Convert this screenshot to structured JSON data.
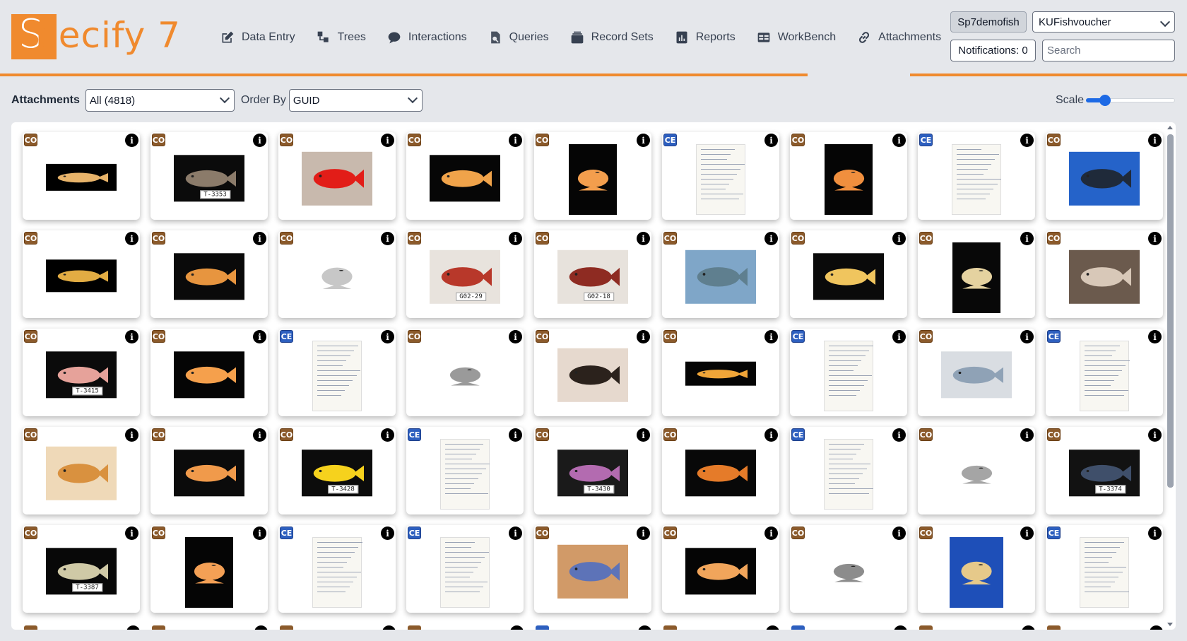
{
  "app": {
    "logo_text": "Specify 7"
  },
  "nav": [
    {
      "label": "Data Entry",
      "icon": "pencil-square-icon"
    },
    {
      "label": "Trees",
      "icon": "tree-icon"
    },
    {
      "label": "Interactions",
      "icon": "chat-icon"
    },
    {
      "label": "Queries",
      "icon": "magnifier-document-icon"
    },
    {
      "label": "Record Sets",
      "icon": "stack-icon"
    },
    {
      "label": "Reports",
      "icon": "report-icon"
    },
    {
      "label": "WorkBench",
      "icon": "table-icon"
    },
    {
      "label": "Attachments",
      "icon": "link-icon"
    }
  ],
  "header": {
    "user": "Sp7demofish",
    "collection": "KUFishvoucher",
    "notifications": "Notifications: 0",
    "search_placeholder": "Search"
  },
  "toolbar": {
    "label": "Attachments",
    "filter_value": "All (4818)",
    "orderby_label": "Order By",
    "orderby_value": "GUID",
    "scale_label": "Scale",
    "scale_level": 0.15
  },
  "colors": {
    "accent": "#f08a2e",
    "co_badge": "#8b5a2b",
    "ce_badge": "#2d5fbf",
    "slider": "#1d6ae5"
  },
  "gallery": {
    "cards": [
      {
        "badge": "CO",
        "thumb": "fish",
        "bg": "#000000",
        "fish": "#e7b36a",
        "w": 100,
        "h": 38,
        "tag": ""
      },
      {
        "badge": "CO",
        "thumb": "fish",
        "bg": "#0b0b0b",
        "fish": "#8b7b6a",
        "w": 100,
        "h": 66,
        "tag": "T-3353"
      },
      {
        "badge": "CO",
        "thumb": "fish",
        "bg": "#c8b9ad",
        "fish": "#e21d18",
        "w": 100,
        "h": 76,
        "tag": ""
      },
      {
        "badge": "CO",
        "thumb": "fish",
        "bg": "#060606",
        "fish": "#f0a34a",
        "w": 100,
        "h": 66,
        "tag": ""
      },
      {
        "badge": "CO",
        "thumb": "fish",
        "bg": "#050505",
        "fish": "#f39e4d",
        "w": 68,
        "h": 100,
        "tag": ""
      },
      {
        "badge": "CE",
        "thumb": "doc",
        "w": 70,
        "h": 100
      },
      {
        "badge": "CO",
        "thumb": "fish",
        "bg": "#050505",
        "fish": "#f08f3e",
        "w": 68,
        "h": 100,
        "tag": ""
      },
      {
        "badge": "CE",
        "thumb": "doc",
        "w": 70,
        "h": 100
      },
      {
        "badge": "CO",
        "thumb": "fish",
        "bg": "#2563c9",
        "fish": "#1f2a3a",
        "w": 100,
        "h": 76,
        "tag": ""
      },
      {
        "badge": "CO",
        "thumb": "fish",
        "bg": "#000000",
        "fish": "#e2ac43",
        "w": 100,
        "h": 46,
        "tag": ""
      },
      {
        "badge": "CO",
        "thumb": "fish",
        "bg": "#0a0a0a",
        "fish": "#e7953f",
        "w": 100,
        "h": 66,
        "tag": ""
      },
      {
        "badge": "CO",
        "thumb": "fish",
        "bg": "#ffffff",
        "fish": "#c7c7c7",
        "w": 70,
        "h": 100,
        "tag": ""
      },
      {
        "badge": "CO",
        "thumb": "fish",
        "bg": "#e8e3dd",
        "fish": "#b8382a",
        "w": 100,
        "h": 76,
        "tag": "G02-29"
      },
      {
        "badge": "CO",
        "thumb": "fish",
        "bg": "#e7e2dc",
        "fish": "#8e2b22",
        "w": 100,
        "h": 76,
        "tag": "G02-18"
      },
      {
        "badge": "CO",
        "thumb": "fish",
        "bg": "#7fa6c8",
        "fish": "#5f7f8f",
        "w": 100,
        "h": 76,
        "tag": ""
      },
      {
        "badge": "CO",
        "thumb": "fish",
        "bg": "#0a0a0a",
        "fish": "#f0c55e",
        "w": 100,
        "h": 66,
        "tag": ""
      },
      {
        "badge": "CO",
        "thumb": "fish",
        "bg": "#080808",
        "fish": "#e5d2a0",
        "w": 68,
        "h": 100,
        "tag": ""
      },
      {
        "badge": "CO",
        "thumb": "fish",
        "bg": "#6b5a4d",
        "fish": "#d8c8b8",
        "w": 100,
        "h": 76,
        "tag": ""
      },
      {
        "badge": "CO",
        "thumb": "fish",
        "bg": "#0b0b0b",
        "fish": "#e6a29a",
        "w": 100,
        "h": 66,
        "tag": "T-3415"
      },
      {
        "badge": "CO",
        "thumb": "fish",
        "bg": "#050505",
        "fish": "#f5a04c",
        "w": 100,
        "h": 66,
        "tag": ""
      },
      {
        "badge": "CE",
        "thumb": "doc",
        "w": 70,
        "h": 100
      },
      {
        "badge": "CO",
        "thumb": "fish",
        "bg": "#ffffff",
        "fish": "#9a9a9a",
        "w": 60,
        "h": 100,
        "tag": ""
      },
      {
        "badge": "CO",
        "thumb": "fish",
        "bg": "#e6d9ce",
        "fish": "#2b221c",
        "w": 100,
        "h": 76,
        "tag": ""
      },
      {
        "badge": "CO",
        "thumb": "fish",
        "bg": "#050505",
        "fish": "#f0a538",
        "w": 100,
        "h": 34,
        "tag": ""
      },
      {
        "badge": "CE",
        "thumb": "doc",
        "w": 70,
        "h": 100
      },
      {
        "badge": "CO",
        "thumb": "fish",
        "bg": "#d9dde2",
        "fish": "#8fa2b6",
        "w": 100,
        "h": 66,
        "tag": ""
      },
      {
        "badge": "CE",
        "thumb": "doc",
        "w": 70,
        "h": 100
      },
      {
        "badge": "CO",
        "thumb": "fish",
        "bg": "#efd9b8",
        "fish": "#d9913f",
        "w": 100,
        "h": 76,
        "tag": ""
      },
      {
        "badge": "CO",
        "thumb": "fish",
        "bg": "#0b0b0b",
        "fish": "#f09a4b",
        "w": 100,
        "h": 66,
        "tag": ""
      },
      {
        "badge": "CO",
        "thumb": "fish",
        "bg": "#0c0c0c",
        "fish": "#f6d21d",
        "w": 100,
        "h": 66,
        "tag": "T-3428"
      },
      {
        "badge": "CE",
        "thumb": "doc",
        "w": 70,
        "h": 100
      },
      {
        "badge": "CO",
        "thumb": "fish",
        "bg": "#1a1a1a",
        "fish": "#b36bb0",
        "w": 100,
        "h": 66,
        "tag": "T-3430"
      },
      {
        "badge": "CO",
        "thumb": "fish",
        "bg": "#080808",
        "fish": "#e57b29",
        "w": 100,
        "h": 66,
        "tag": ""
      },
      {
        "badge": "CE",
        "thumb": "doc",
        "w": 70,
        "h": 100
      },
      {
        "badge": "CO",
        "thumb": "fish",
        "bg": "#ffffff",
        "fish": "#a5a5a5",
        "w": 60,
        "h": 100,
        "tag": ""
      },
      {
        "badge": "CO",
        "thumb": "fish",
        "bg": "#121212",
        "fish": "#3f4f6a",
        "w": 100,
        "h": 66,
        "tag": "T-3374"
      },
      {
        "badge": "CO",
        "thumb": "fish",
        "bg": "#080808",
        "fish": "#cfc9a6",
        "w": 100,
        "h": 66,
        "tag": "T-3387"
      },
      {
        "badge": "CO",
        "thumb": "fish",
        "bg": "#050505",
        "fish": "#f4a055",
        "w": 68,
        "h": 100,
        "tag": ""
      },
      {
        "badge": "CE",
        "thumb": "doc",
        "w": 70,
        "h": 100
      },
      {
        "badge": "CE",
        "thumb": "doc",
        "w": 70,
        "h": 100
      },
      {
        "badge": "CO",
        "thumb": "fish",
        "bg": "#d19a68",
        "fish": "#5d73b8",
        "w": 100,
        "h": 76,
        "tag": ""
      },
      {
        "badge": "CO",
        "thumb": "fish",
        "bg": "#050505",
        "fish": "#f1a55b",
        "w": 100,
        "h": 66,
        "tag": ""
      },
      {
        "badge": "CO",
        "thumb": "fish",
        "bg": "#ffffff",
        "fish": "#8c8c8c",
        "w": 60,
        "h": 100,
        "tag": ""
      },
      {
        "badge": "CO",
        "thumb": "fish",
        "bg": "#1e4fb8",
        "fish": "#e6c98a",
        "w": 76,
        "h": 100,
        "tag": ""
      },
      {
        "badge": "CE",
        "thumb": "doc",
        "w": 70,
        "h": 100
      }
    ],
    "peek_badges": [
      "CO",
      "CO",
      "CO",
      "CO",
      "CE",
      "CO",
      "CE",
      "CO",
      "CO"
    ]
  }
}
